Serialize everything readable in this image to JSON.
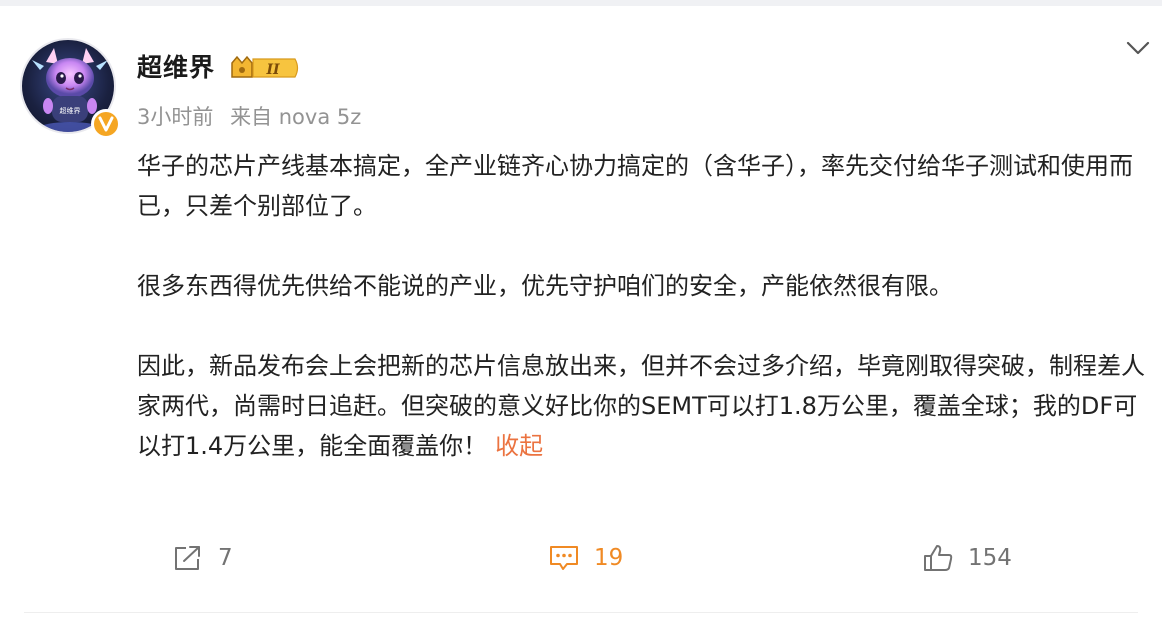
{
  "post": {
    "author": {
      "name": "超维界",
      "avatar_icon": "dragon-avatar-icon",
      "avatar_caption": "超维界",
      "verified_icon": "orange-v-icon",
      "vip_level": "II"
    },
    "time": "3小时前",
    "source": "来自 nova 5z",
    "paragraphs": [
      "华子的芯片产线基本搞定，全产业链齐心协力搞定的（含华子），率先交付给华子测试和使用而已，只差个别部位了。",
      "很多东西得优先供给不能说的产业，优先守护咱们的安全，产能依然很有限。",
      "因此，新品发布会上会把新的芯片信息放出来，但并不会过多介绍，毕竟刚取得突破，制程差人家两代，尚需时日追赶。但突破的意义好比你的SEMT可以打1.8万公里，覆盖全球；我的DF可以打1.4万公里，能全面覆盖你！"
    ],
    "collapse_label": "收起",
    "actions": {
      "repost_count": "7",
      "comment_count": "19",
      "like_count": "154"
    },
    "colors": {
      "accent": "#eb7340",
      "comment_active": "#f08a24",
      "text": "#222222",
      "meta": "#939393"
    }
  }
}
